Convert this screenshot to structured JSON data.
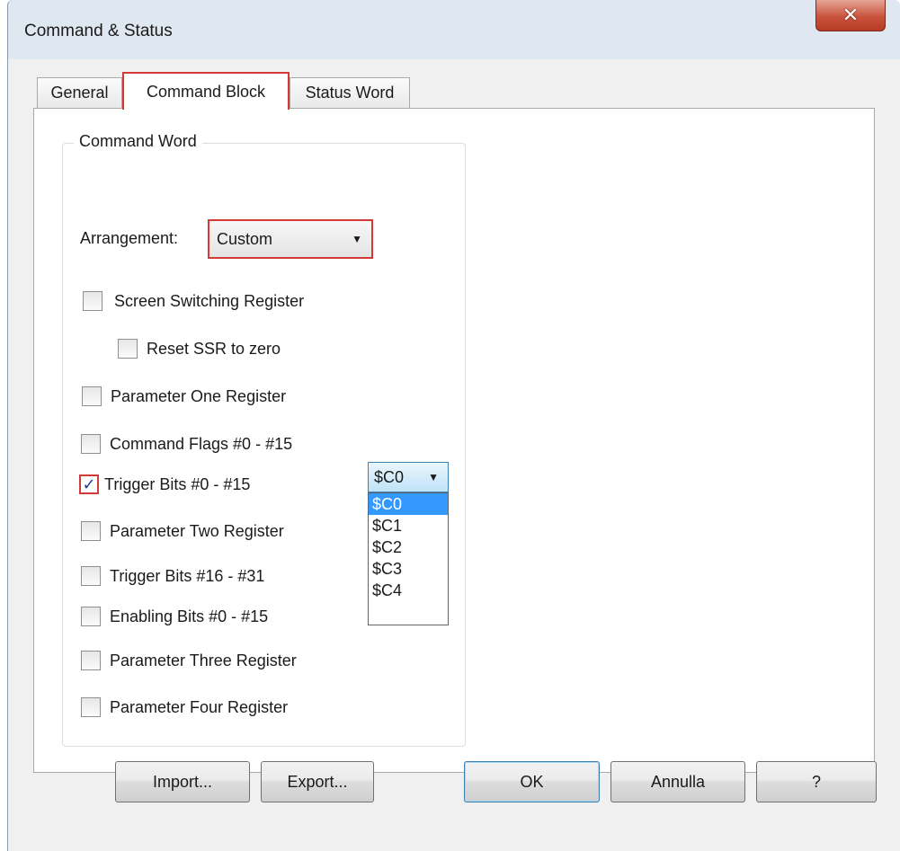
{
  "window": {
    "title": "Command & Status",
    "close_icon": "close-icon"
  },
  "tabs": [
    {
      "label": "General",
      "active": false
    },
    {
      "label": "Command Block",
      "active": true
    },
    {
      "label": "Status Word",
      "active": false
    }
  ],
  "group": {
    "title": "Command Word",
    "arrangement_label": "Arrangement:",
    "arrangement_value": "Custom"
  },
  "checkboxes": [
    {
      "label": "Screen Switching Register",
      "checked": false
    },
    {
      "label": "Reset SSR to zero",
      "checked": false
    },
    {
      "label": "Parameter One Register",
      "checked": false
    },
    {
      "label": "Command Flags #0 - #15",
      "checked": false
    },
    {
      "label": "Trigger Bits #0 - #15",
      "checked": true
    },
    {
      "label": "Parameter Two Register",
      "checked": false
    },
    {
      "label": "Trigger Bits #16 - #31",
      "checked": false
    },
    {
      "label": "Enabling Bits #0 - #15",
      "checked": false
    },
    {
      "label": "Parameter Three Register",
      "checked": false
    },
    {
      "label": "Parameter Four Register",
      "checked": false
    }
  ],
  "trigger_select": {
    "value": "$C0",
    "options": [
      "$C0",
      "$C1",
      "$C2",
      "$C3",
      "$C4"
    ],
    "selected_index": 0
  },
  "buttons": {
    "import": "Import...",
    "export": "Export...",
    "ok": "OK",
    "cancel": "Annulla",
    "help": "?"
  },
  "colors": {
    "highlight": "#d23a3a",
    "selection": "#3399ff",
    "check": "#1c3f94"
  }
}
